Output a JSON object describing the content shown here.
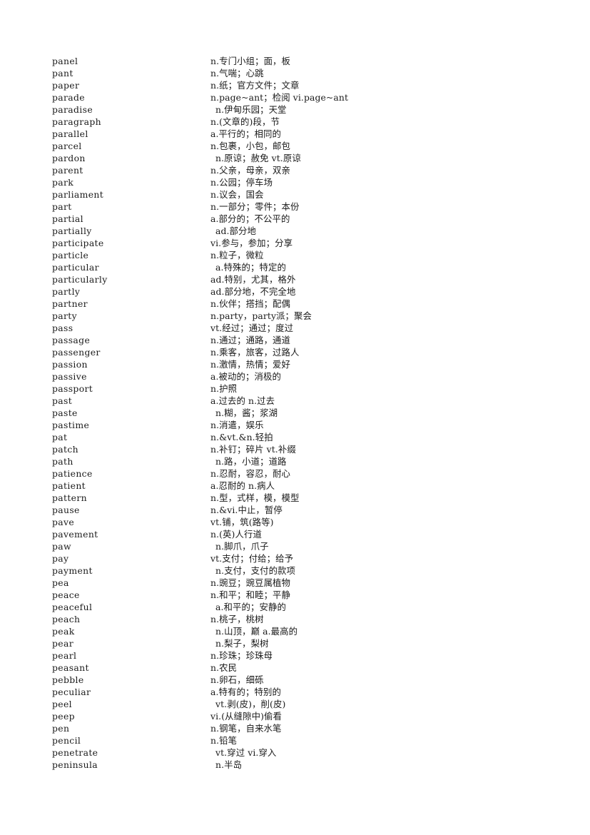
{
  "page": {
    "type": "vocabulary-list",
    "language_pair": "English-Chinese",
    "background_color": "#ffffff",
    "text_color": "#1a1a1a",
    "row_count": 59
  },
  "entries": [
    {
      "term": "panel",
      "definition": "n.专门小组；面，板",
      "indent": false
    },
    {
      "term": "pant",
      "definition": "n.气喘；心跳",
      "indent": false
    },
    {
      "term": "paper",
      "definition": "n.纸；官方文件；文章",
      "indent": false
    },
    {
      "term": "parade",
      "definition": "n.page~ant；检阅 vi.page~ant",
      "indent": false
    },
    {
      "term": "paradise",
      "definition": "n.伊甸乐园；天堂",
      "indent": true
    },
    {
      "term": "paragraph",
      "definition": "n.(文章的)段，节",
      "indent": false
    },
    {
      "term": "parallel",
      "definition": "a.平行的；相同的",
      "indent": false
    },
    {
      "term": "parcel",
      "definition": "n.包裹，小包，邮包",
      "indent": false
    },
    {
      "term": "pardon",
      "definition": "n.原谅；赦免 vt.原谅",
      "indent": true
    },
    {
      "term": "parent",
      "definition": "n.父亲，母亲，双亲",
      "indent": false
    },
    {
      "term": "park",
      "definition": "n.公园；停车场",
      "indent": false
    },
    {
      "term": "parliament",
      "definition": "n.议会，国会",
      "indent": false
    },
    {
      "term": "part",
      "definition": "n.一部分；零件；本份",
      "indent": false
    },
    {
      "term": "partial",
      "definition": "a.部分的；不公平的",
      "indent": false
    },
    {
      "term": "partially",
      "definition": "ad.部分地",
      "indent": true
    },
    {
      "term": "participate",
      "definition": "vi.参与，参加；分享",
      "indent": false
    },
    {
      "term": "particle",
      "definition": "n.粒子，微粒",
      "indent": false
    },
    {
      "term": "particular",
      "definition": "a.特殊的；特定的",
      "indent": true
    },
    {
      "term": "particularly",
      "definition": "ad.特别，尤其，格外",
      "indent": false
    },
    {
      "term": "partly",
      "definition": "ad.部分地，不完全地",
      "indent": false
    },
    {
      "term": "partner",
      "definition": "n.伙伴；搭挡；配偶",
      "indent": false
    },
    {
      "term": "party",
      "definition": "n.party，party派；聚会",
      "indent": false
    },
    {
      "term": "pass",
      "definition": "vt.经过；通过；度过",
      "indent": false
    },
    {
      "term": "passage",
      "definition": "n.通过；通路，通道",
      "indent": false
    },
    {
      "term": "passenger",
      "definition": "n.乘客，旅客，过路人",
      "indent": false
    },
    {
      "term": "passion",
      "definition": "n.激情，热情；爱好",
      "indent": false
    },
    {
      "term": "passive",
      "definition": "a.被动的；消极的",
      "indent": false
    },
    {
      "term": "passport",
      "definition": "n.护照",
      "indent": false
    },
    {
      "term": "past",
      "definition": "a.过去的 n.过去",
      "indent": false
    },
    {
      "term": "paste",
      "definition": "n.糊，酱；浆湖",
      "indent": true
    },
    {
      "term": "pastime",
      "definition": "n.消遣，娱乐",
      "indent": false
    },
    {
      "term": "pat",
      "definition": "n.&vt.&n.轻拍",
      "indent": false
    },
    {
      "term": "patch",
      "definition": "n.补钉；碎片 vt.补缀",
      "indent": false
    },
    {
      "term": "path",
      "definition": "n.路，小道；道路",
      "indent": true
    },
    {
      "term": "patience",
      "definition": "n.忍耐，容忍，耐心",
      "indent": false
    },
    {
      "term": "patient",
      "definition": "a.忍耐的 n.病人",
      "indent": false
    },
    {
      "term": "pattern",
      "definition": "n.型，式样，模，模型",
      "indent": false
    },
    {
      "term": "pause",
      "definition": "n.&vi.中止，暂停",
      "indent": false
    },
    {
      "term": "pave",
      "definition": "vt.铺，筑(路等)",
      "indent": false
    },
    {
      "term": "pavement",
      "definition": "n.(英)人行道",
      "indent": false
    },
    {
      "term": "paw",
      "definition": "n.脚爪，爪子",
      "indent": true
    },
    {
      "term": "pay",
      "definition": "vt.支付；付给；给予",
      "indent": false
    },
    {
      "term": "payment",
      "definition": "n.支付，支付的款项",
      "indent": true
    },
    {
      "term": "pea",
      "definition": "n.豌豆；豌豆属植物",
      "indent": false
    },
    {
      "term": "peace",
      "definition": "n.和平；和睦；平静",
      "indent": false
    },
    {
      "term": "peaceful",
      "definition": "a.和平的；安静的",
      "indent": true
    },
    {
      "term": "peach",
      "definition": "n.桃子，桃树",
      "indent": false
    },
    {
      "term": "peak",
      "definition": "n.山顶，巅 a.最高的",
      "indent": true
    },
    {
      "term": "pear",
      "definition": "n.梨子，梨树",
      "indent": true
    },
    {
      "term": "pearl",
      "definition": "n.珍珠；珍珠母",
      "indent": false
    },
    {
      "term": "peasant",
      "definition": "n.农民",
      "indent": false
    },
    {
      "term": "pebble",
      "definition": "n.卵石，细砾",
      "indent": false
    },
    {
      "term": "peculiar",
      "definition": "a.特有的；特别的",
      "indent": false
    },
    {
      "term": "peel",
      "definition": "vt.剥(皮)，削(皮)",
      "indent": true
    },
    {
      "term": "peep",
      "definition": "vi.(从缝隙中)偷看",
      "indent": false
    },
    {
      "term": "pen",
      "definition": "n.钢笔，自来水笔",
      "indent": false
    },
    {
      "term": "pencil",
      "definition": "n.铅笔",
      "indent": false
    },
    {
      "term": "penetrate",
      "definition": "vt.穿过 vi.穿入",
      "indent": true
    },
    {
      "term": "peninsula",
      "definition": "n.半岛",
      "indent": true
    }
  ]
}
